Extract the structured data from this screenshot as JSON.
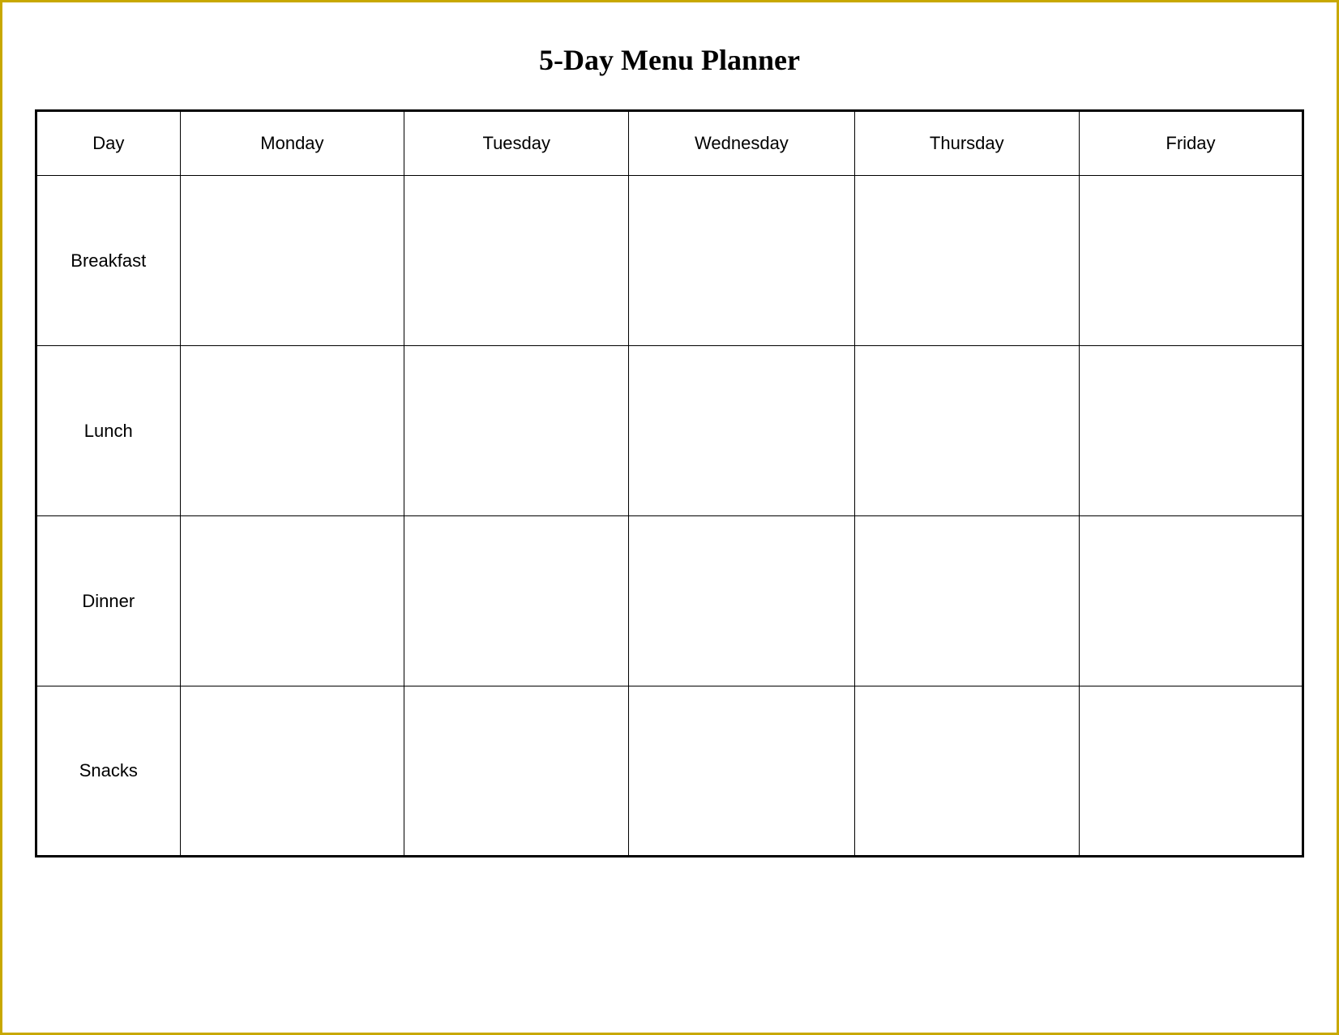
{
  "title": "5-Day Menu Planner",
  "table": {
    "headers": [
      "Day",
      "Monday",
      "Tuesday",
      "Wednesday",
      "Thursday",
      "Friday"
    ],
    "rows": [
      {
        "label": "Breakfast"
      },
      {
        "label": "Lunch"
      },
      {
        "label": "Dinner"
      },
      {
        "label": "Snacks"
      }
    ]
  }
}
